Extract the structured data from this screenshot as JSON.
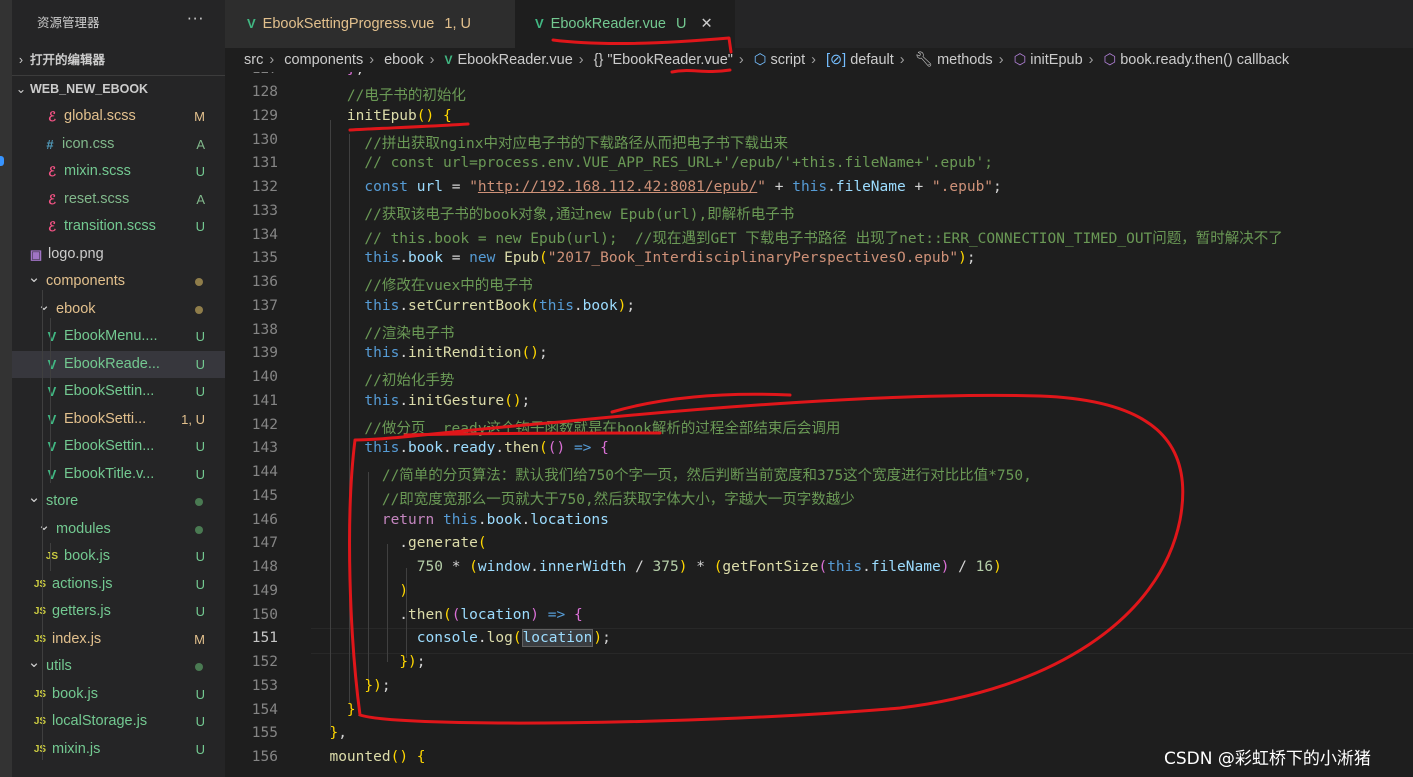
{
  "sidebar": {
    "title": "资源管理器",
    "more": "···",
    "open_editors": "打开的编辑器",
    "project": "WEB_NEW_EBOOK",
    "items": [
      {
        "name": "global.scss",
        "status": "M",
        "icon": "sass-icon",
        "glyph": "ℰ",
        "color": "#e2c08d",
        "icolor": "#f55385"
      },
      {
        "name": "icon.css",
        "status": "A",
        "icon": "hash-icon",
        "glyph": "#",
        "color": "#81b88b",
        "icolor": "#519aba"
      },
      {
        "name": "mixin.scss",
        "status": "U",
        "icon": "sass-icon",
        "glyph": "ℰ",
        "color": "#73c991",
        "icolor": "#f55385"
      },
      {
        "name": "reset.scss",
        "status": "A",
        "icon": "sass-icon",
        "glyph": "ℰ",
        "color": "#81b88b",
        "icolor": "#f55385"
      },
      {
        "name": "transition.scss",
        "status": "U",
        "icon": "sass-icon",
        "glyph": "ℰ",
        "color": "#73c991",
        "icolor": "#f55385"
      },
      {
        "name": "logo.png",
        "status": "",
        "icon": "image-icon",
        "glyph": "▣",
        "color": "#cccccc",
        "icolor": "#a074c4"
      },
      {
        "name": "components",
        "status": "dot",
        "icon": "chevron-down-icon",
        "glyph": "⌄",
        "color": "#e2c08d",
        "icolor": "#cccccc"
      },
      {
        "name": "ebook",
        "status": "dot",
        "icon": "chevron-down-icon",
        "glyph": "⌄",
        "color": "#e2c08d",
        "icolor": "#cccccc"
      },
      {
        "name": "EbookMenu....",
        "status": "U",
        "icon": "vue-icon",
        "glyph": "V",
        "color": "#73c991",
        "icolor": "#41b883"
      },
      {
        "name": "EbookReade...",
        "status": "U",
        "icon": "vue-icon",
        "glyph": "V",
        "color": "#73c991",
        "icolor": "#41b883"
      },
      {
        "name": "EbookSettin...",
        "status": "U",
        "icon": "vue-icon",
        "glyph": "V",
        "color": "#73c991",
        "icolor": "#41b883"
      },
      {
        "name": "EbookSetti...",
        "status": "1, U",
        "icon": "vue-icon",
        "glyph": "V",
        "color": "#e2c08d",
        "icolor": "#41b883"
      },
      {
        "name": "EbookSettin...",
        "status": "U",
        "icon": "vue-icon",
        "glyph": "V",
        "color": "#73c991",
        "icolor": "#41b883"
      },
      {
        "name": "EbookTitle.v...",
        "status": "U",
        "icon": "vue-icon",
        "glyph": "V",
        "color": "#73c991",
        "icolor": "#41b883"
      },
      {
        "name": "store",
        "status": "dotg",
        "icon": "chevron-down-icon",
        "glyph": "⌄",
        "color": "#73c991",
        "icolor": "#cccccc"
      },
      {
        "name": "modules",
        "status": "dotg",
        "icon": "chevron-down-icon",
        "glyph": "⌄",
        "color": "#73c991",
        "icolor": "#cccccc"
      },
      {
        "name": "book.js",
        "status": "U",
        "icon": "js-icon",
        "glyph": "JS",
        "color": "#73c991",
        "icolor": "#cbcb41"
      },
      {
        "name": "actions.js",
        "status": "U",
        "icon": "js-icon",
        "glyph": "JS",
        "color": "#73c991",
        "icolor": "#cbcb41"
      },
      {
        "name": "getters.js",
        "status": "U",
        "icon": "js-icon",
        "glyph": "JS",
        "color": "#73c991",
        "icolor": "#cbcb41"
      },
      {
        "name": "index.js",
        "status": "M",
        "icon": "js-icon",
        "glyph": "JS",
        "color": "#e2c08d",
        "icolor": "#cbcb41"
      },
      {
        "name": "utils",
        "status": "dotg",
        "icon": "chevron-down-icon",
        "glyph": "⌄",
        "color": "#73c991",
        "icolor": "#cccccc"
      },
      {
        "name": "book.js",
        "status": "U",
        "icon": "js-icon",
        "glyph": "JS",
        "color": "#73c991",
        "icolor": "#cbcb41"
      },
      {
        "name": "localStorage.js",
        "status": "U",
        "icon": "js-icon",
        "glyph": "JS",
        "color": "#73c991",
        "icolor": "#cbcb41"
      },
      {
        "name": "mixin.js",
        "status": "U",
        "icon": "js-icon",
        "glyph": "JS",
        "color": "#73c991",
        "icolor": "#cbcb41"
      }
    ]
  },
  "tabs": [
    {
      "label": "EbookSettingProgress.vue",
      "status": "1, U"
    },
    {
      "label": "EbookReader.vue",
      "status": "U",
      "close": "✕"
    }
  ],
  "breadcrumbs": {
    "p1": "src",
    "p2": "components",
    "p3": "ebook",
    "p4": "EbookReader.vue",
    "p5": "\"EbookReader.vue\"",
    "p6": "script",
    "p7": "default",
    "p8": "methods",
    "p9": "initEpub",
    "p10": "book.ready.then() callback"
  },
  "editor": {
    "partial_top_line": "127",
    "current_line": "151",
    "lines": [
      {
        "n": "128",
        "t": "    //电子书的初始化"
      },
      {
        "n": "129",
        "t": "    initEpub() {"
      },
      {
        "n": "130",
        "t": "      //拼出获取nginx中对应电子书的下载路径从而把电子书下载出来"
      },
      {
        "n": "131",
        "t": "      // const url=process.env.VUE_APP_RES_URL+'/epub/'+this.fileName+'.epub';"
      },
      {
        "n": "132",
        "t": "      const url = \"http://192.168.112.42:8081/epub/\" + this.fileName + \".epub\";"
      },
      {
        "n": "133",
        "t": "      //获取该电子书的book对象,通过new Epub(url),即解析电子书"
      },
      {
        "n": "134",
        "t": "      // this.book = new Epub(url);  //现在遇到GET 下载电子书路径 出现了net::ERR_CONNECTION_TIMED_OUT问题，暂时解决不了"
      },
      {
        "n": "135",
        "t": "      this.book = new Epub(\"2017_Book_InterdisciplinaryPerspectivesO.epub\");"
      },
      {
        "n": "136",
        "t": "      //修改在vuex中的电子书"
      },
      {
        "n": "137",
        "t": "      this.setCurrentBook(this.book);"
      },
      {
        "n": "138",
        "t": "      //渲染电子书"
      },
      {
        "n": "139",
        "t": "      this.initRendition();"
      },
      {
        "n": "140",
        "t": "      //初始化手势"
      },
      {
        "n": "141",
        "t": "      this.initGesture();"
      },
      {
        "n": "142",
        "t": "      //做分页  ready这个钩子函数就是在book解析的过程全部结束后会调用"
      },
      {
        "n": "143",
        "t": "      this.book.ready.then(() => {"
      },
      {
        "n": "144",
        "t": "        //简单的分页算法：默认我们给750个字一页，然后判断当前宽度和375这个宽度进行对比比值*750,"
      },
      {
        "n": "145",
        "t": "        //即宽度宽那么一页就大于750,然后获取字体大小，字越大一页字数越少"
      },
      {
        "n": "146",
        "t": "        return this.book.locations"
      },
      {
        "n": "147",
        "t": "          .generate("
      },
      {
        "n": "148",
        "t": "            750 * (window.innerWidth / 375) * (getFontSize(this.fileName) / 16)"
      },
      {
        "n": "149",
        "t": "          )"
      },
      {
        "n": "150",
        "t": "          .then((location) => {"
      },
      {
        "n": "151",
        "t": "            console.log(location);"
      },
      {
        "n": "152",
        "t": "          });"
      },
      {
        "n": "153",
        "t": "      });"
      },
      {
        "n": "154",
        "t": "    },"
      },
      {
        "n": "155",
        "t": "  },"
      },
      {
        "n": "156",
        "t": "  mounted() {"
      }
    ]
  },
  "watermark": "CSDN @彩虹桥下的小淅猪",
  "colors": {
    "annotation": "#e0161a",
    "vue": "#41b883",
    "untracked": "#73c991",
    "modified": "#e2c08d"
  }
}
